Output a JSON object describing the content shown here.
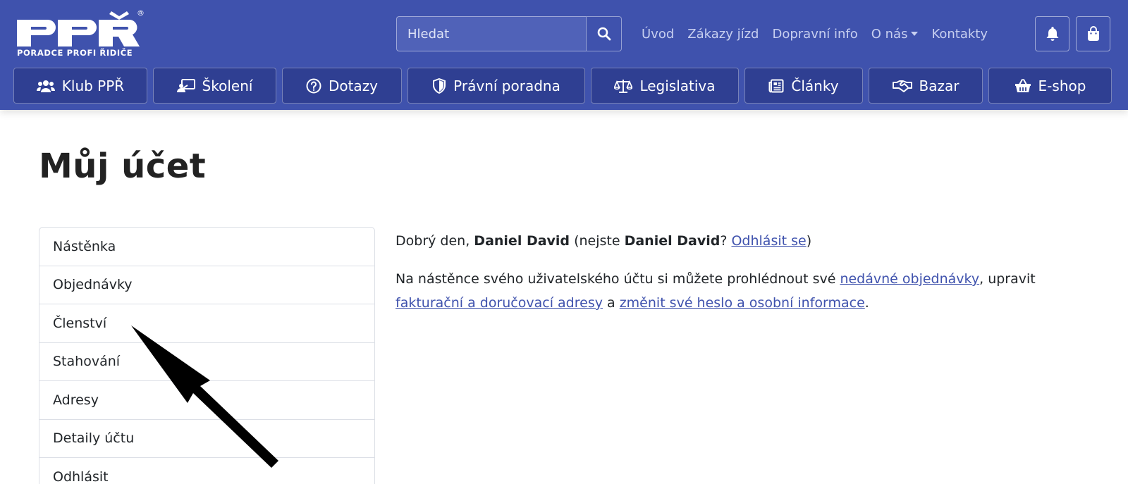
{
  "logo": {
    "main": "PPŘ",
    "tagline": "PORADCE PROFI ŘIDIČE",
    "mark": "®"
  },
  "search": {
    "placeholder": "Hledat",
    "icon": "search-icon"
  },
  "topnav": [
    {
      "label": "Úvod"
    },
    {
      "label": "Zákazy jízd"
    },
    {
      "label": "Dopravní info"
    },
    {
      "label": "O nás",
      "has_dropdown": true
    },
    {
      "label": "Kontakty"
    }
  ],
  "header_icons": {
    "notifications": "bell-icon",
    "cart": "shopping-bag-icon"
  },
  "mainnav": [
    {
      "label": "Klub PPŘ",
      "icon": "users-icon"
    },
    {
      "label": "Školení",
      "icon": "teacher-icon"
    },
    {
      "label": "Dotazy",
      "icon": "question-circle-icon"
    },
    {
      "label": "Právní poradna",
      "icon": "shield-icon"
    },
    {
      "label": "Legislativa",
      "icon": "scales-icon"
    },
    {
      "label": "Články",
      "icon": "newspaper-icon"
    },
    {
      "label": "Bazar",
      "icon": "handshake-icon"
    },
    {
      "label": "E-shop",
      "icon": "basket-icon"
    }
  ],
  "page": {
    "title": "Můj účet"
  },
  "account_menu": [
    {
      "label": "Nástěnka"
    },
    {
      "label": "Objednávky"
    },
    {
      "label": "Členství"
    },
    {
      "label": "Stahování"
    },
    {
      "label": "Adresy"
    },
    {
      "label": "Detaily účtu"
    },
    {
      "label": "Odhlásit"
    }
  ],
  "content": {
    "greeting_prefix": "Dobrý den, ",
    "user_name": "Daniel David",
    "not_you_prefix": " (nejste ",
    "not_you_user": "Daniel David",
    "not_you_q": "? ",
    "logout_link": "Odhlásit se",
    "close_paren": ")",
    "dashboard_text_1": "Na nástěnce svého uživatelského účtu si můžete prohlédnout své ",
    "orders_link": "nedávné objednávky",
    "dashboard_text_2": ", upravit ",
    "addresses_link": "fakturační a doručovací adresy",
    "dashboard_text_3": " a ",
    "account_link": "změnit své heslo a osobní informace",
    "dashboard_text_4": "."
  },
  "colors": {
    "header_bg": "#3f52ad",
    "nav_button_bg": "#2f3f92",
    "link": "#3f52ad"
  }
}
